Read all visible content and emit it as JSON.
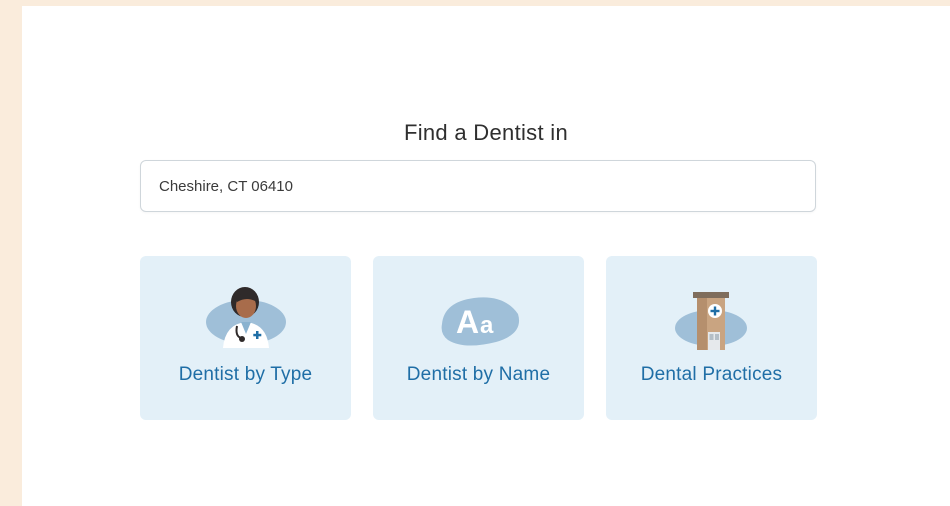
{
  "search": {
    "heading": "Find a Dentist in",
    "location_value": "Cheshire, CT 06410"
  },
  "cards": [
    {
      "label": "Dentist by Type",
      "icon": "dentist-icon"
    },
    {
      "label": "Dentist by Name",
      "icon": "text-aa-icon"
    },
    {
      "label": "Dental Practices",
      "icon": "building-icon"
    }
  ],
  "colors": {
    "page_background": "#faecdc",
    "card_background": "#e3f0f8",
    "label_blue": "#1f6ea6",
    "blob_blue": "#9fbfd8"
  }
}
